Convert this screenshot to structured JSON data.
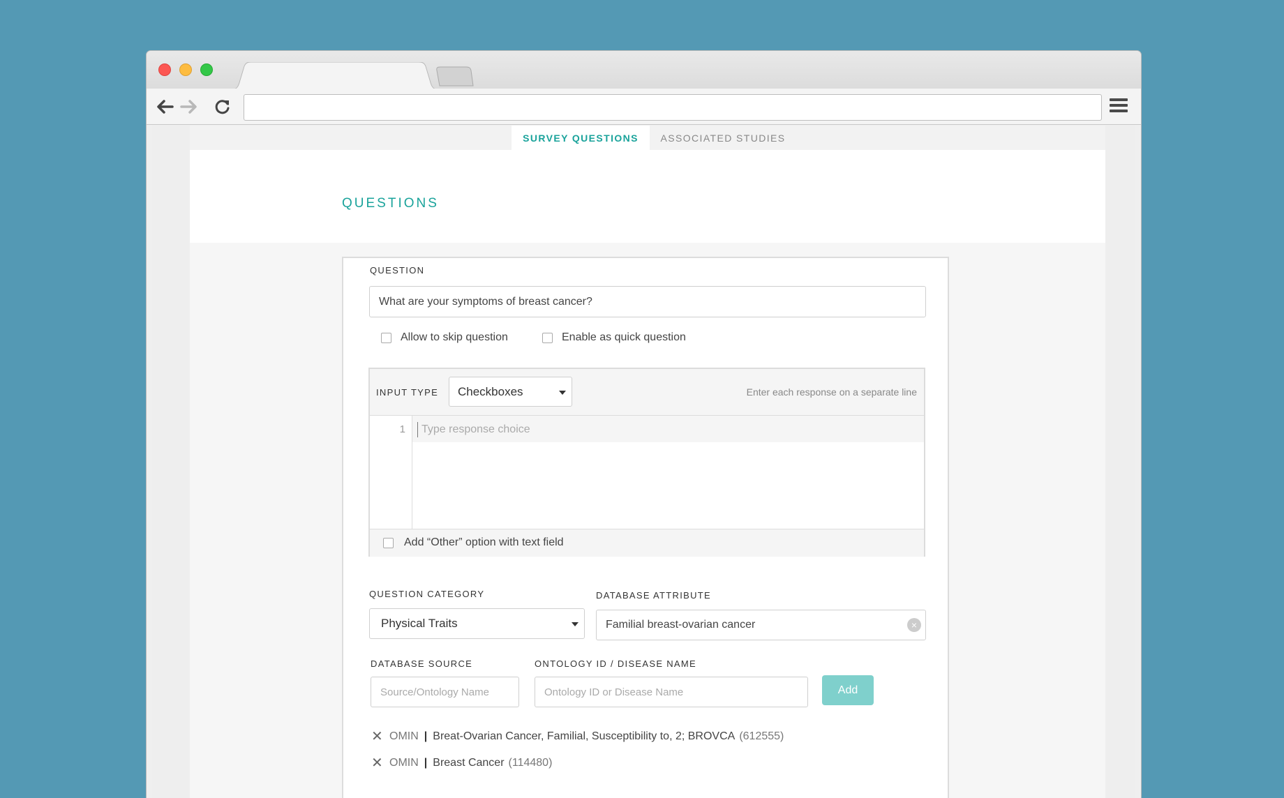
{
  "browser": {
    "url": "",
    "icons": [
      "back-arrow-icon",
      "forward-arrow-icon",
      "reload-icon",
      "hamburger-menu-icon"
    ]
  },
  "subnav": {
    "tabs": [
      {
        "label": "SURVEY QUESTIONS",
        "active": true
      },
      {
        "label": "ASSOCIATED STUDIES",
        "active": false
      }
    ]
  },
  "section": {
    "title": "QUESTIONS"
  },
  "question": {
    "label": "QUESTION",
    "value": "What are your symptoms of breast cancer?",
    "options": [
      {
        "label": "Allow to skip question",
        "checked": false
      },
      {
        "label": "Enable as quick question",
        "checked": false
      }
    ]
  },
  "responses": {
    "input_type_label": "INPUT TYPE",
    "input_type_value": "Checkboxes",
    "hint": "Enter each response on a separate line",
    "line_number": "1",
    "line_placeholder": "Type response choice",
    "other_option_label": "Add “Other” option with text field"
  },
  "category": {
    "label": "QUESTION CATEGORY",
    "value": "Physical Traits"
  },
  "db_attribute": {
    "label": "DATABASE ATTRIBUTE",
    "value": "Familial breast-ovarian cancer"
  },
  "db_source": {
    "label": "DATABASE SOURCE",
    "placeholder": "Source/Ontology Name"
  },
  "ontology": {
    "label": "ONTOLOGY ID / DISEASE NAME",
    "placeholder": "Ontology ID or Disease Name",
    "add_label": "Add"
  },
  "tags": [
    {
      "source": "OMIN",
      "separator": "|",
      "name": "Breat-Ovarian Cancer, Familial, Susceptibility to, 2; BROVCA",
      "id": "(612555)"
    },
    {
      "source": "OMIN",
      "separator": "|",
      "name": "Breast Cancer",
      "id": "(114480)"
    }
  ],
  "colors": {
    "background": "#5499b4",
    "accent": "#1aa39b",
    "add_button": "#7fd0cc"
  }
}
